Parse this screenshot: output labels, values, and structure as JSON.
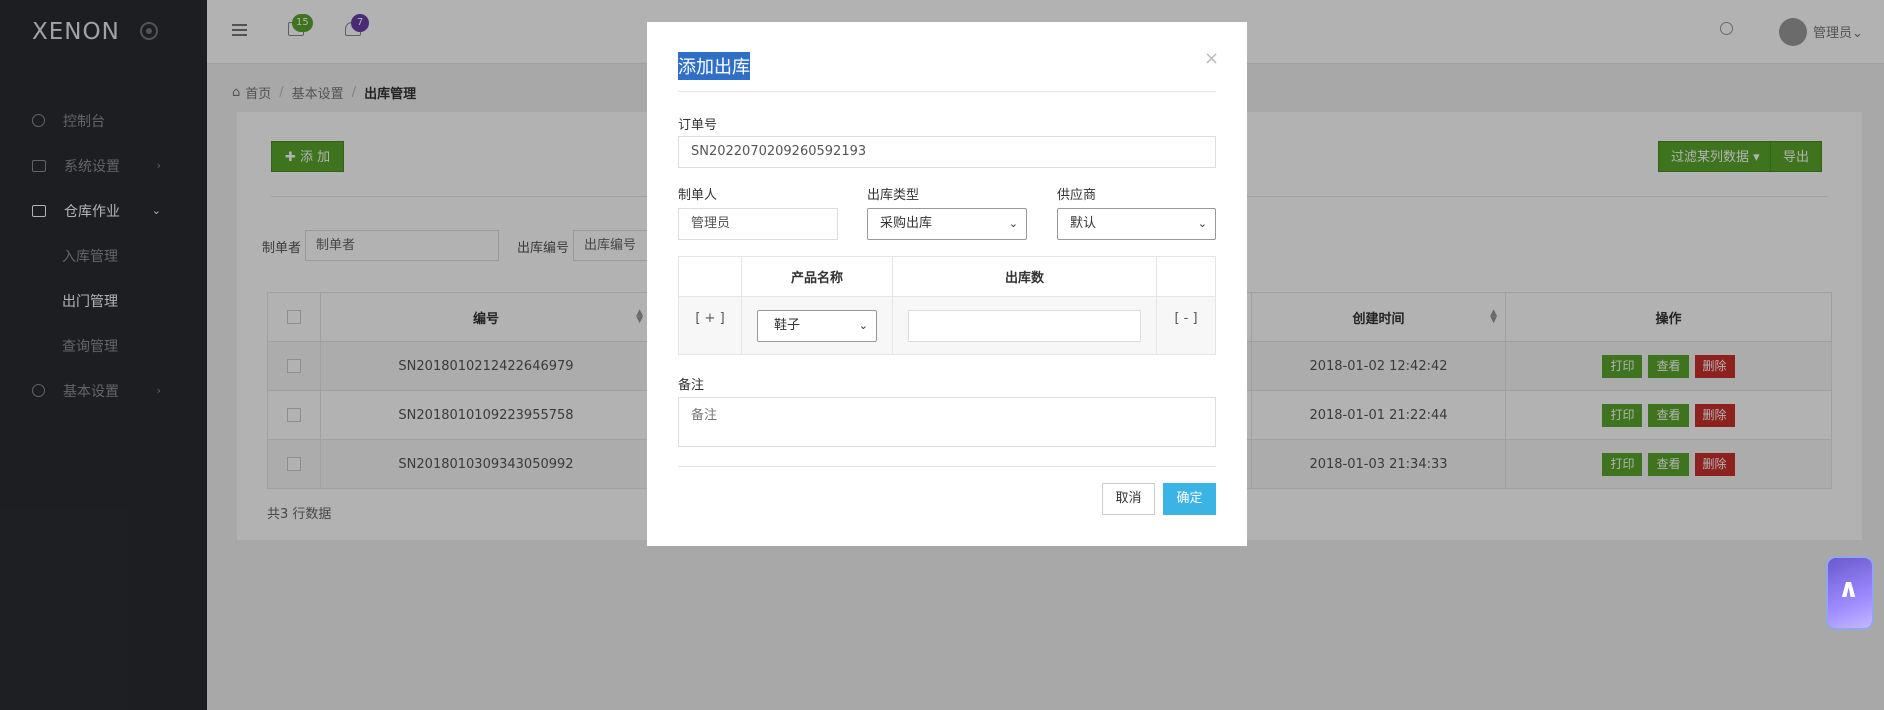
{
  "app": {
    "logo": "XENON"
  },
  "sidebar": {
    "items": [
      {
        "label": "控制台"
      },
      {
        "label": "系统设置",
        "chevron": "›"
      },
      {
        "label": "仓库作业",
        "chevron": "⌄"
      },
      {
        "label": "基本设置",
        "chevron": "›"
      }
    ],
    "subitems": [
      {
        "label": "入库管理"
      },
      {
        "label": "出门管理"
      },
      {
        "label": "查询管理"
      }
    ]
  },
  "topbar": {
    "mail_badge": "15",
    "bell_badge": "7",
    "user_name": "管理员⌄",
    "colors": {
      "mail_badge": "#5aa62a",
      "bell_badge": "#6a3da8"
    }
  },
  "breadcrumb": {
    "home": "首页",
    "level1": "基本设置",
    "current": "出库管理",
    "sep": "/"
  },
  "toolbar": {
    "add_label": "✚ 添 加",
    "filter_label": "过滤某列数据 ▾",
    "export_label": "导出"
  },
  "filters": {
    "maker_label": "制单者",
    "maker_placeholder": "制单者",
    "outno_label": "出库编号",
    "outno_placeholder": "出库编号"
  },
  "table": {
    "headers": {
      "id": "编号",
      "created": "创建时间",
      "ops": "操作"
    },
    "rows": [
      {
        "id": "SN2018010212422646979",
        "created": "2018-01-02 12:42:42"
      },
      {
        "id": "SN2018010109223955758",
        "created": "2018-01-01 21:22:44"
      },
      {
        "id": "SN2018010309343050992",
        "created": "2018-01-03 21:34:33"
      }
    ],
    "ops": {
      "print": "打印",
      "view": "查看",
      "delete": "删除"
    },
    "footer": "共3 行数据"
  },
  "modal": {
    "title": "添加出库",
    "close": "×",
    "order_label": "订单号",
    "order_value": "SN2022070209260592193",
    "maker_label": "制单人",
    "maker_value": "管理员",
    "type_label": "出库类型",
    "type_value": "采购出库",
    "supplier_label": "供应商",
    "supplier_value": "默认",
    "product_header": "产品名称",
    "qty_header": "出库数",
    "add_row": "[ + ]",
    "remove_row": "[ - ]",
    "product_value": "鞋子",
    "remark_label": "备注",
    "remark_placeholder": "备注",
    "cancel": "取消",
    "ok": "确定"
  }
}
